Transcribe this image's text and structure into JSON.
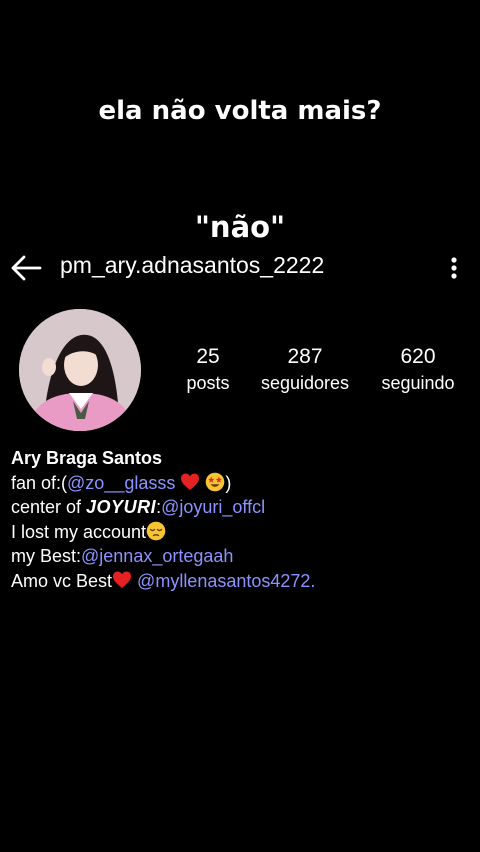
{
  "overlay": {
    "caption_top": "ela não volta mais?",
    "caption_bottom": "\"não\""
  },
  "header": {
    "username": "pm_ary.adnasantos_2222",
    "back_icon": "arrow-left-icon",
    "more_icon": "more-vertical-icon"
  },
  "stats": {
    "posts_count": "25",
    "posts_label": "posts",
    "followers_count": "287",
    "followers_label": "seguidores",
    "following_count": "620",
    "following_label": "seguindo"
  },
  "bio": {
    "name": "Ary Braga Santos",
    "fan_prefix": "fan of:(",
    "fan_mention": "@zo__glasss",
    "fan_suffix": ")",
    "center_prefix": "center of ",
    "center_brand": "JOYURI",
    "center_colon": ":",
    "center_mention": "@joyuri_offcl",
    "lost_text": "I lost my account",
    "best_prefix": "my Best:",
    "best_mention": "@jennax_ortegaah",
    "amo_prefix": "Amo vc Best",
    "amo_mention": "@myllenasantos4272",
    "amo_suffix": "."
  },
  "colors": {
    "background": "#000000",
    "text": "#ffffff",
    "mention": "#8c93ff"
  }
}
